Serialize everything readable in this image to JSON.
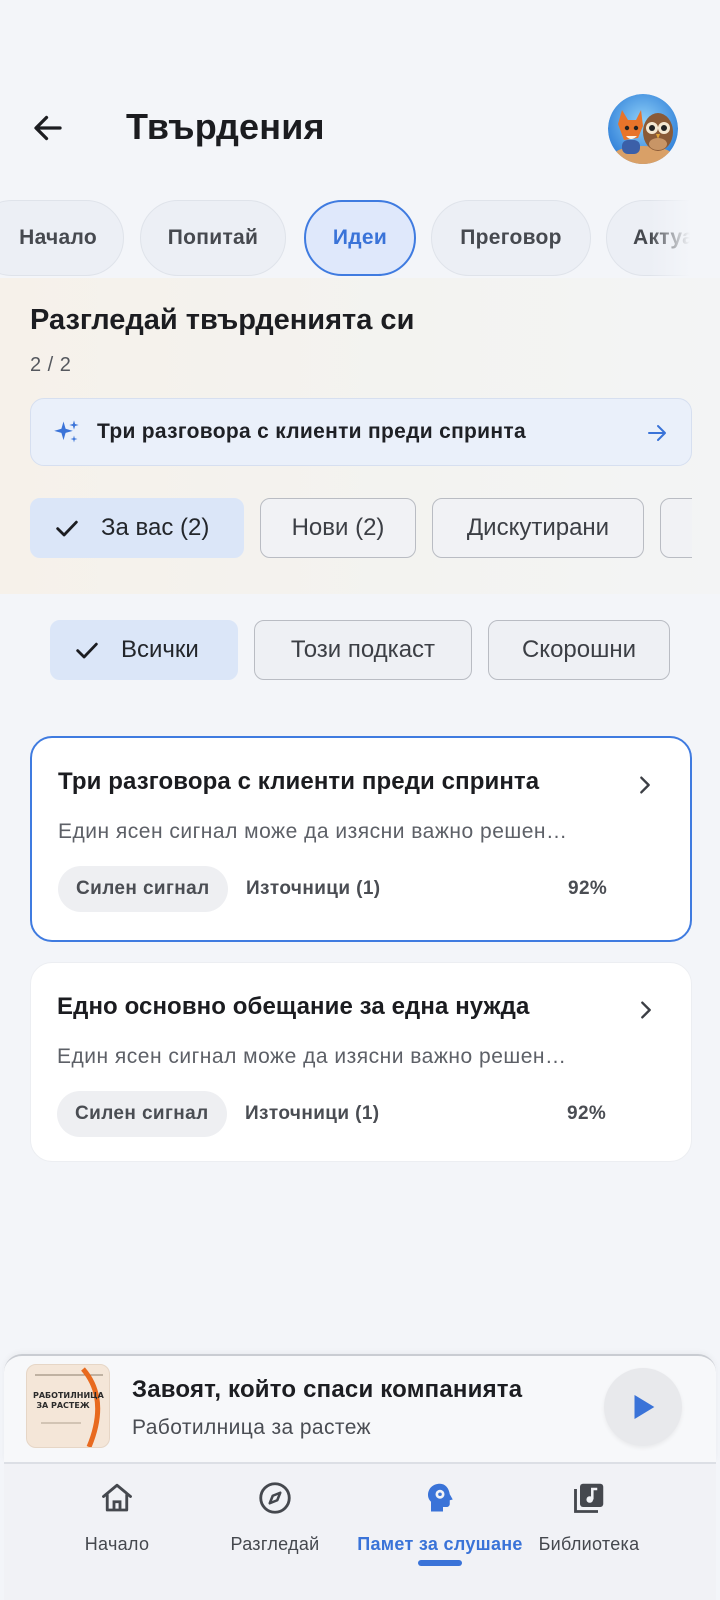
{
  "header": {
    "title": "Твърдения"
  },
  "tabs": [
    {
      "label": "Начало"
    },
    {
      "label": "Попитай"
    },
    {
      "label": "Идеи"
    },
    {
      "label": "Преговор"
    },
    {
      "label": "Актуално"
    }
  ],
  "explore": {
    "title": "Разгледай твърденията си",
    "count": "2 / 2",
    "prompt": "Три разговора с клиенти преди спринта",
    "filters": [
      {
        "label": "За вас (2)"
      },
      {
        "label": "Нови (2)"
      },
      {
        "label": "Дискутирани"
      }
    ]
  },
  "subfilters": [
    {
      "label": "Всички"
    },
    {
      "label": "Този подкаст"
    },
    {
      "label": "Скорошни"
    }
  ],
  "cards": [
    {
      "title": "Три разговора с клиенти преди спринта",
      "description": "Един ясен сигнал може да изясни важно решен…",
      "badge": "Силен сигнал",
      "sources": "Източници (1)",
      "score": "92%"
    },
    {
      "title": "Едно основно обещание за една нужда",
      "description": "Един ясен сигнал може да изясни важно решен…",
      "badge": "Силен сигнал",
      "sources": "Източници (1)",
      "score": "92%"
    }
  ],
  "player": {
    "title": "Завоят, който спаси компанията",
    "subtitle": "Работилница за растеж",
    "cover_text": "РАБОТИЛНИЦА ЗА РАСТЕЖ"
  },
  "nav": [
    {
      "label": "Начало",
      "icon": "home-icon"
    },
    {
      "label": "Разгледай",
      "icon": "compass-icon"
    },
    {
      "label": "Памет за слушане",
      "icon": "memory-icon"
    },
    {
      "label": "Библиотека",
      "icon": "library-icon"
    }
  ],
  "colors": {
    "accent": "#3a73d8",
    "background": "#f3f5f9",
    "card": "#ffffff"
  }
}
